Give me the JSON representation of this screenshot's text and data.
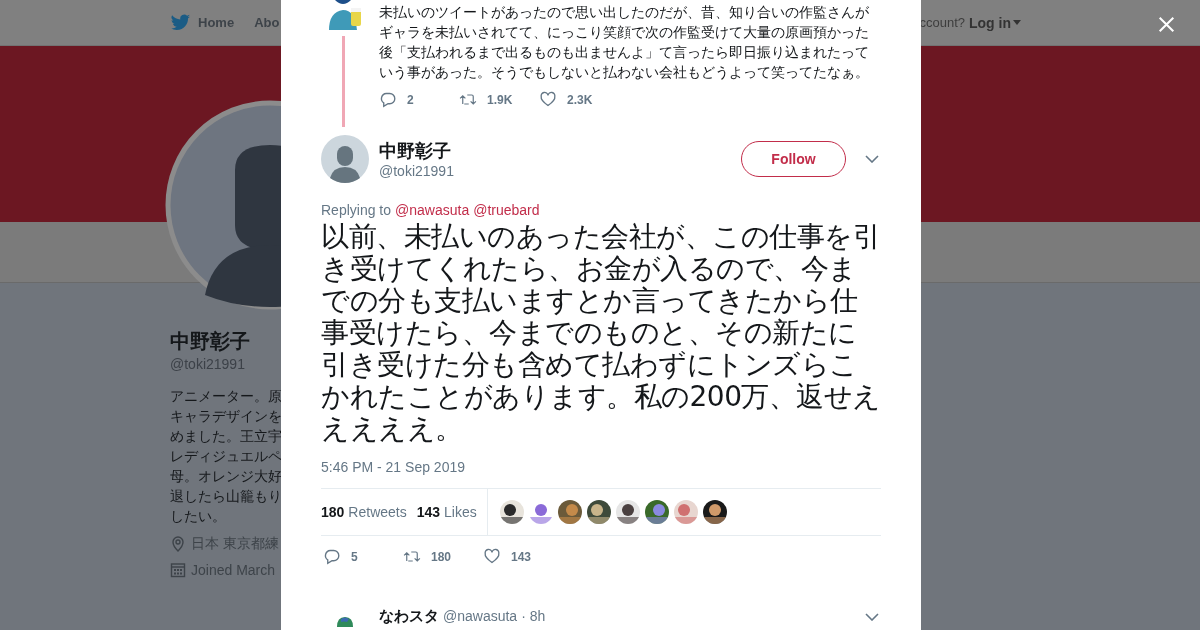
{
  "background_page": {
    "nav": [
      {
        "kind": "home",
        "label": "Home"
      },
      {
        "kind": "plain",
        "label": "Abo"
      }
    ],
    "login_prompt": "ccount?",
    "login_link": "Log in",
    "profile": {
      "name": "中野彰子",
      "handle": "@toki21991",
      "bio_lines": [
        "アニメーター。原",
        "キャラデザインを",
        "めました。王立宇",
        "レディジュエルペ",
        "母。オレンジ大好",
        "退したら山籠もり",
        "したい。"
      ],
      "location": "日本 東京都練",
      "joined": "Joined March"
    }
  },
  "modal": {
    "parent_tweet": {
      "text": "未払いのツイートがあったので思い出したのだが、昔、知り合いの作監さんがギャラを未払いされてて、にっこり笑顔で次の作監受けて大量の原画預かった後「支払われるまで出るものも出ませんよ」て言ったら即日振り込まれたっていう事があった。そうでもしないと払わない会社もどうよって笑ってたなぁ。",
      "actions": [
        {
          "kind": "reply",
          "count": "2"
        },
        {
          "kind": "retweet",
          "count": "1.9K"
        },
        {
          "kind": "like",
          "count": "2.3K"
        }
      ]
    },
    "tweet": {
      "name": "中野彰子",
      "handle": "@toki21991",
      "follow": "Follow",
      "replying_prefix": "Replying to",
      "replying_to": [
        "@nawasuta",
        "@truebard"
      ],
      "text": "以前、未払いのあった会社が、この仕事を引き受けてくれたら、お金が入るので、今までの分も支払いますとか言ってきたから仕事受けたら、今までのものと、その新たに引き受けた分も含めて払わずにトンズらこかれたことがあります。私の200万、返せえええええ。",
      "timestamp": "5:46 PM - 21 Sep 2019",
      "stats": [
        {
          "count": "180",
          "label": "Retweets"
        },
        {
          "count": "143",
          "label": "Likes"
        }
      ],
      "likers": [
        {
          "kind": "picture"
        },
        {
          "kind": "picture"
        },
        {
          "kind": "picture"
        },
        {
          "kind": "picture"
        },
        {
          "kind": "picture"
        },
        {
          "kind": "picture"
        },
        {
          "kind": "picture"
        },
        {
          "kind": "picture"
        }
      ],
      "actions": [
        {
          "kind": "reply",
          "count": "5"
        },
        {
          "kind": "retweet",
          "count": "180"
        },
        {
          "kind": "like",
          "count": "143"
        }
      ]
    },
    "next_tweet": {
      "name": "なわスタ",
      "handle": "@nawasuta",
      "separator": "·",
      "time": "8h"
    }
  }
}
